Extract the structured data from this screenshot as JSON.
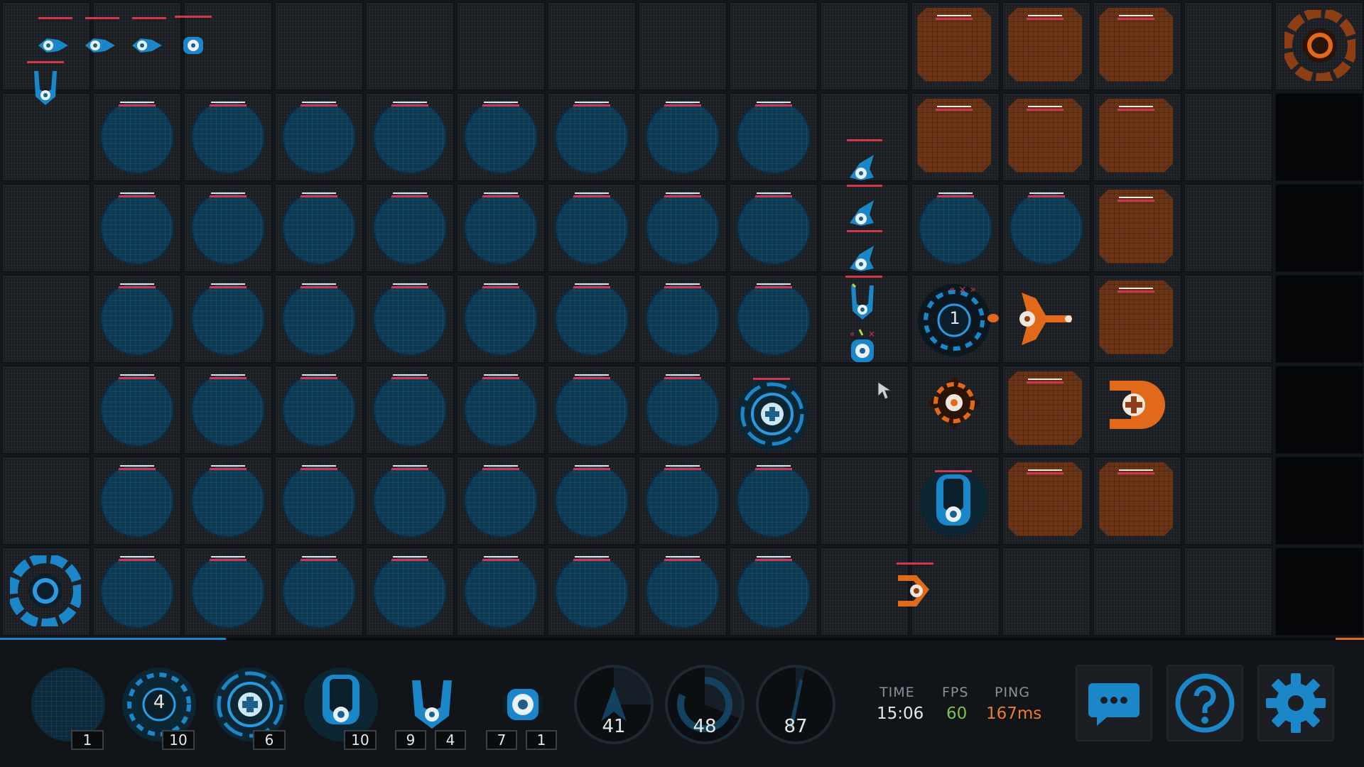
{
  "palette": {
    "blue": "#1b86c8",
    "orange": "#e06a1a",
    "health": "#d2374b",
    "fps_color": "#7fc24a",
    "ping_color": "#f07a2a"
  },
  "board": {
    "description_icons": [
      "blue-base-icon",
      "orange-base-icon",
      "blue-tile",
      "orange-tile"
    ],
    "selected_base_level": "1"
  },
  "inventory": [
    {
      "name": "empty-tile-slot",
      "icon": "empty-tile-icon",
      "counts": [
        "1"
      ]
    },
    {
      "name": "gear-tower-slot",
      "icon": "gear-tower-icon",
      "label": "4",
      "counts": [
        "10"
      ]
    },
    {
      "name": "medic-slot",
      "icon": "medic-icon",
      "counts": [
        "6"
      ]
    },
    {
      "name": "cannon-slot",
      "icon": "cannon-icon",
      "counts": [
        "10"
      ]
    },
    {
      "name": "fighter-slot",
      "icon": "fighter-icon",
      "counts": [
        "9",
        "4"
      ]
    },
    {
      "name": "drone-slot",
      "icon": "drone-icon",
      "counts": [
        "7",
        "1"
      ]
    }
  ],
  "gauges": [
    {
      "name": "attack-gauge",
      "value": "41"
    },
    {
      "name": "energy-gauge",
      "value": "48"
    },
    {
      "name": "resource-gauge",
      "value": "87"
    }
  ],
  "stats": {
    "time_label": "TIME",
    "time_value": "15:06",
    "fps_label": "FPS",
    "fps_value": "60",
    "ping_label": "PING",
    "ping_value": "167ms"
  },
  "buttons": [
    {
      "name": "chat-button",
      "icon": "chat-icon"
    },
    {
      "name": "help-button",
      "icon": "help-icon"
    },
    {
      "name": "settings-button",
      "icon": "gear-icon"
    }
  ]
}
